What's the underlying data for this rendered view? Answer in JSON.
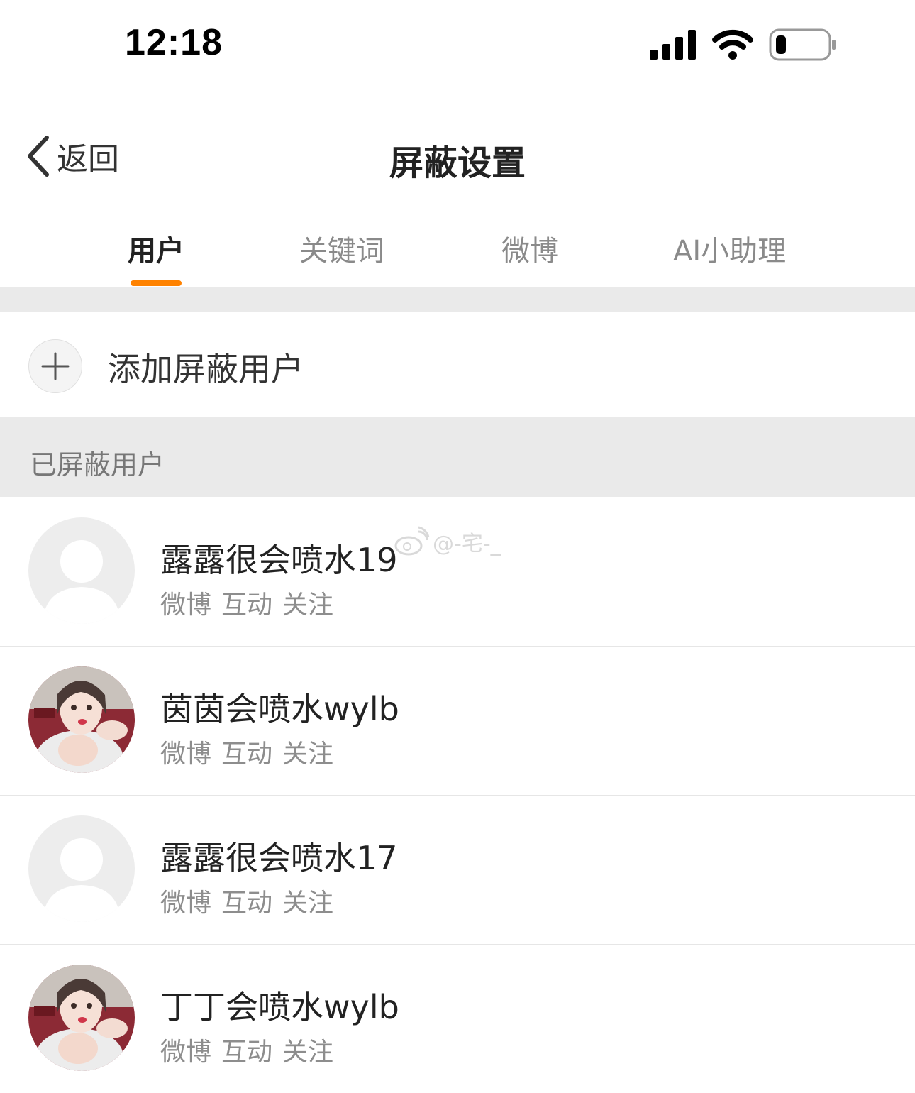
{
  "status_bar": {
    "time": "12:18",
    "battery_icon": "battery-low-icon",
    "wifi_icon": "wifi-icon",
    "signal_icon": "cellular-signal-icon"
  },
  "nav": {
    "back_label": "返回",
    "title": "屏蔽设置"
  },
  "tabs": [
    {
      "label": "用户",
      "active": true
    },
    {
      "label": "关键词",
      "active": false
    },
    {
      "label": "微博",
      "active": false
    },
    {
      "label": "AI小助理",
      "active": false
    }
  ],
  "accent_color": "#ff8200",
  "add_user": {
    "label": "添加屏蔽用户",
    "icon": "plus-icon"
  },
  "section": {
    "label": "已屏蔽用户"
  },
  "users": [
    {
      "name": "露露很会喷水19",
      "avatar": "default-avatar",
      "tags": [
        "微博",
        "互动",
        "关注"
      ]
    },
    {
      "name": "茵茵会喷水wylb",
      "avatar": "photo-avatar",
      "tags": [
        "微博",
        "互动",
        "关注"
      ]
    },
    {
      "name": "露露很会喷水17",
      "avatar": "default-avatar",
      "tags": [
        "微博",
        "互动",
        "关注"
      ]
    },
    {
      "name": "丁丁会喷水wylb",
      "avatar": "photo-avatar",
      "tags": [
        "微博",
        "互动",
        "关注"
      ]
    }
  ],
  "watermark": {
    "text": "@-宅-_"
  }
}
